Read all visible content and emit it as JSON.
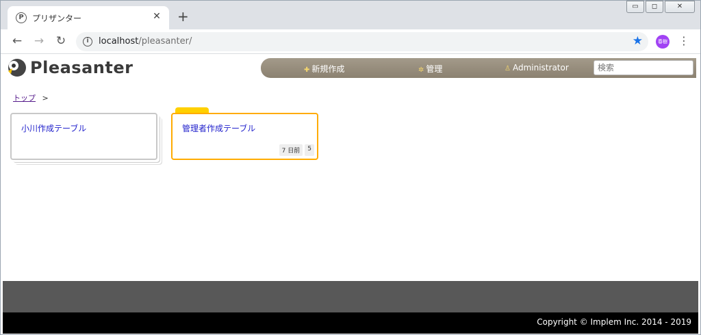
{
  "browser": {
    "tab_title": "プリザンター",
    "tab_favicon": "P",
    "close_glyph": "✕",
    "newtab_glyph": "+",
    "url_host": "localhost",
    "url_path": "/pleasanter/",
    "profile_label": "春樹",
    "profile_color": "#a142f4"
  },
  "app": {
    "logo_text": "Pleasanter",
    "nav": {
      "new_label": "新規作成",
      "manage_label": "管理",
      "user_label": "Administrator"
    },
    "search_placeholder": "検索",
    "breadcrumb": {
      "top_label": "トップ",
      "separator": ">"
    },
    "cards": [
      {
        "title": "小川作成テーブル"
      },
      {
        "title": "管理者作成テーブル",
        "updated": "7 日前",
        "count": "5"
      }
    ],
    "copyright": "Copyright © Implem Inc. 2014 - 2019"
  },
  "colors": {
    "accent_border": "#ffab00",
    "card_tab": "#ffd000",
    "nav_bg": "#9a9080",
    "link": "#2222cc"
  }
}
